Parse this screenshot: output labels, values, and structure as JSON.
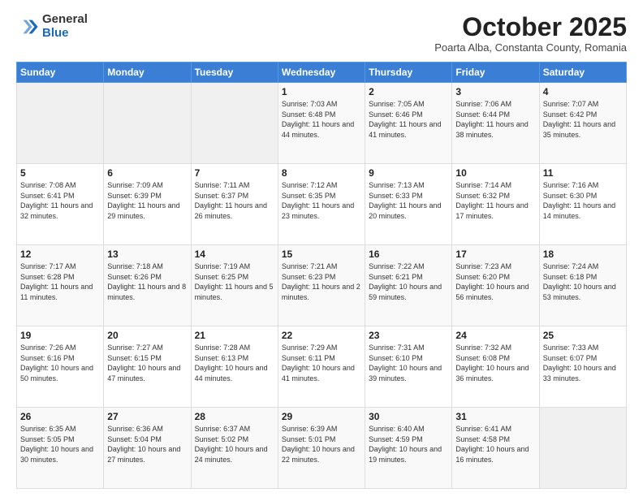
{
  "header": {
    "logo_general": "General",
    "logo_blue": "Blue",
    "month_title": "October 2025",
    "subtitle": "Poarta Alba, Constanta County, Romania"
  },
  "days_of_week": [
    "Sunday",
    "Monday",
    "Tuesday",
    "Wednesday",
    "Thursday",
    "Friday",
    "Saturday"
  ],
  "weeks": [
    [
      {
        "day": "",
        "info": ""
      },
      {
        "day": "",
        "info": ""
      },
      {
        "day": "",
        "info": ""
      },
      {
        "day": "1",
        "info": "Sunrise: 7:03 AM\nSunset: 6:48 PM\nDaylight: 11 hours and 44 minutes."
      },
      {
        "day": "2",
        "info": "Sunrise: 7:05 AM\nSunset: 6:46 PM\nDaylight: 11 hours and 41 minutes."
      },
      {
        "day": "3",
        "info": "Sunrise: 7:06 AM\nSunset: 6:44 PM\nDaylight: 11 hours and 38 minutes."
      },
      {
        "day": "4",
        "info": "Sunrise: 7:07 AM\nSunset: 6:42 PM\nDaylight: 11 hours and 35 minutes."
      }
    ],
    [
      {
        "day": "5",
        "info": "Sunrise: 7:08 AM\nSunset: 6:41 PM\nDaylight: 11 hours and 32 minutes."
      },
      {
        "day": "6",
        "info": "Sunrise: 7:09 AM\nSunset: 6:39 PM\nDaylight: 11 hours and 29 minutes."
      },
      {
        "day": "7",
        "info": "Sunrise: 7:11 AM\nSunset: 6:37 PM\nDaylight: 11 hours and 26 minutes."
      },
      {
        "day": "8",
        "info": "Sunrise: 7:12 AM\nSunset: 6:35 PM\nDaylight: 11 hours and 23 minutes."
      },
      {
        "day": "9",
        "info": "Sunrise: 7:13 AM\nSunset: 6:33 PM\nDaylight: 11 hours and 20 minutes."
      },
      {
        "day": "10",
        "info": "Sunrise: 7:14 AM\nSunset: 6:32 PM\nDaylight: 11 hours and 17 minutes."
      },
      {
        "day": "11",
        "info": "Sunrise: 7:16 AM\nSunset: 6:30 PM\nDaylight: 11 hours and 14 minutes."
      }
    ],
    [
      {
        "day": "12",
        "info": "Sunrise: 7:17 AM\nSunset: 6:28 PM\nDaylight: 11 hours and 11 minutes."
      },
      {
        "day": "13",
        "info": "Sunrise: 7:18 AM\nSunset: 6:26 PM\nDaylight: 11 hours and 8 minutes."
      },
      {
        "day": "14",
        "info": "Sunrise: 7:19 AM\nSunset: 6:25 PM\nDaylight: 11 hours and 5 minutes."
      },
      {
        "day": "15",
        "info": "Sunrise: 7:21 AM\nSunset: 6:23 PM\nDaylight: 11 hours and 2 minutes."
      },
      {
        "day": "16",
        "info": "Sunrise: 7:22 AM\nSunset: 6:21 PM\nDaylight: 10 hours and 59 minutes."
      },
      {
        "day": "17",
        "info": "Sunrise: 7:23 AM\nSunset: 6:20 PM\nDaylight: 10 hours and 56 minutes."
      },
      {
        "day": "18",
        "info": "Sunrise: 7:24 AM\nSunset: 6:18 PM\nDaylight: 10 hours and 53 minutes."
      }
    ],
    [
      {
        "day": "19",
        "info": "Sunrise: 7:26 AM\nSunset: 6:16 PM\nDaylight: 10 hours and 50 minutes."
      },
      {
        "day": "20",
        "info": "Sunrise: 7:27 AM\nSunset: 6:15 PM\nDaylight: 10 hours and 47 minutes."
      },
      {
        "day": "21",
        "info": "Sunrise: 7:28 AM\nSunset: 6:13 PM\nDaylight: 10 hours and 44 minutes."
      },
      {
        "day": "22",
        "info": "Sunrise: 7:29 AM\nSunset: 6:11 PM\nDaylight: 10 hours and 41 minutes."
      },
      {
        "day": "23",
        "info": "Sunrise: 7:31 AM\nSunset: 6:10 PM\nDaylight: 10 hours and 39 minutes."
      },
      {
        "day": "24",
        "info": "Sunrise: 7:32 AM\nSunset: 6:08 PM\nDaylight: 10 hours and 36 minutes."
      },
      {
        "day": "25",
        "info": "Sunrise: 7:33 AM\nSunset: 6:07 PM\nDaylight: 10 hours and 33 minutes."
      }
    ],
    [
      {
        "day": "26",
        "info": "Sunrise: 6:35 AM\nSunset: 5:05 PM\nDaylight: 10 hours and 30 minutes."
      },
      {
        "day": "27",
        "info": "Sunrise: 6:36 AM\nSunset: 5:04 PM\nDaylight: 10 hours and 27 minutes."
      },
      {
        "day": "28",
        "info": "Sunrise: 6:37 AM\nSunset: 5:02 PM\nDaylight: 10 hours and 24 minutes."
      },
      {
        "day": "29",
        "info": "Sunrise: 6:39 AM\nSunset: 5:01 PM\nDaylight: 10 hours and 22 minutes."
      },
      {
        "day": "30",
        "info": "Sunrise: 6:40 AM\nSunset: 4:59 PM\nDaylight: 10 hours and 19 minutes."
      },
      {
        "day": "31",
        "info": "Sunrise: 6:41 AM\nSunset: 4:58 PM\nDaylight: 10 hours and 16 minutes."
      },
      {
        "day": "",
        "info": ""
      }
    ]
  ]
}
